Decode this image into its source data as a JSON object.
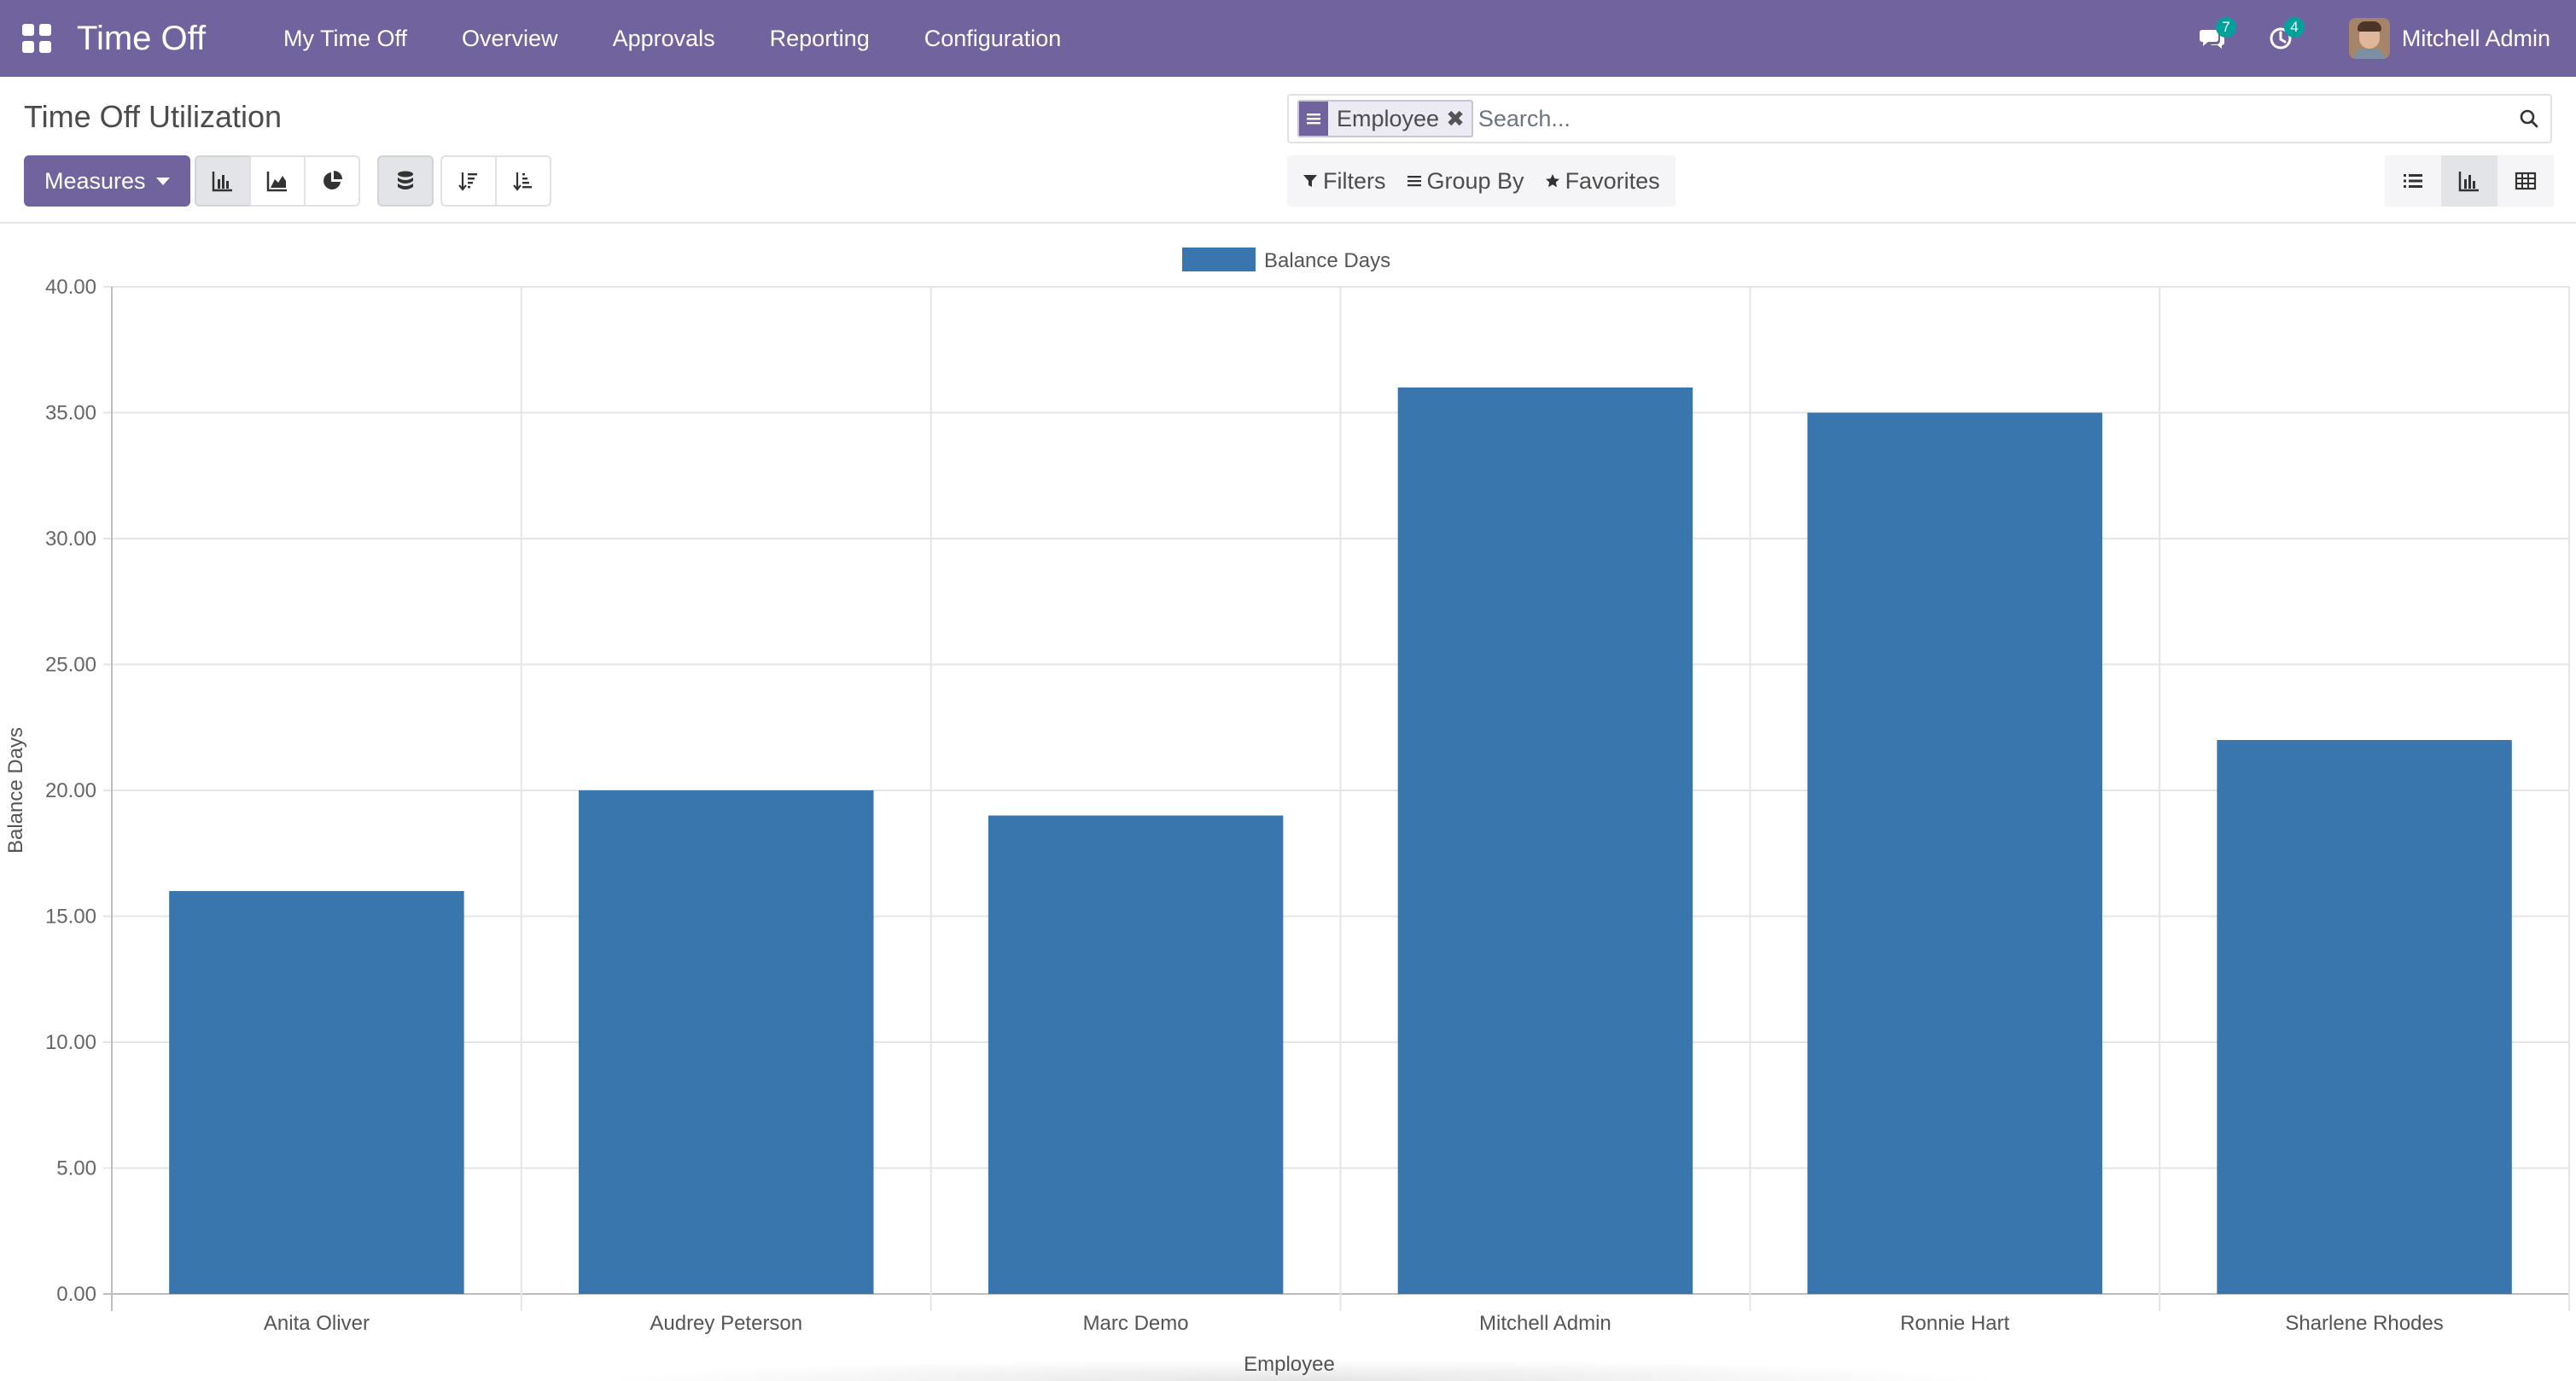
{
  "navbar": {
    "app_title": "Time Off",
    "menu": [
      "My Time Off",
      "Overview",
      "Approvals",
      "Reporting",
      "Configuration"
    ],
    "messages_count": "7",
    "activities_count": "4",
    "user_name": "Mitchell Admin"
  },
  "control_panel": {
    "page_title": "Time Off Utilization",
    "measures_label": "Measures",
    "search": {
      "facet_label": "Employee",
      "placeholder": "Search..."
    },
    "filters_label": "Filters",
    "group_by_label": "Group By",
    "favorites_label": "Favorites"
  },
  "colors": {
    "navbar": "#71639e",
    "bar": "#3a76ae",
    "grid": "#e5e5e5"
  },
  "chart_data": {
    "type": "bar",
    "categories": [
      "Anita Oliver",
      "Audrey Peterson",
      "Marc Demo",
      "Mitchell Admin",
      "Ronnie Hart",
      "Sharlene Rhodes"
    ],
    "series": [
      {
        "name": "Balance Days",
        "values": [
          16,
          20,
          19,
          36,
          35,
          22
        ]
      }
    ],
    "xlabel": "Employee",
    "ylabel": "Balance Days",
    "ylim": [
      0,
      40
    ],
    "yticks": [
      "0.00",
      "5.00",
      "10.00",
      "15.00",
      "20.00",
      "25.00",
      "30.00",
      "35.00",
      "40.00"
    ],
    "legend": "top-center",
    "grid": true
  }
}
